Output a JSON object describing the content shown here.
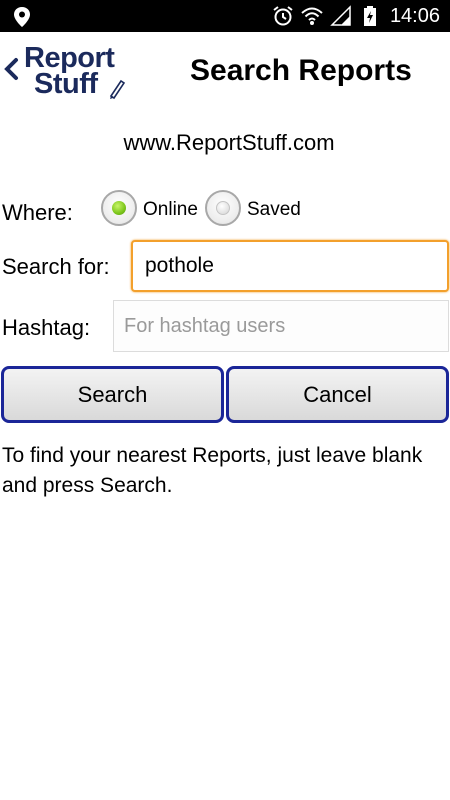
{
  "status_bar": {
    "time": "14:06",
    "icons": [
      "location-icon",
      "alarm-icon",
      "wifi-icon",
      "signal-icon",
      "battery-charging-icon"
    ]
  },
  "header": {
    "logo_line1": "Report",
    "logo_line2": "Stuff",
    "title": "Search Reports"
  },
  "site_url": "www.ReportStuff.com",
  "where": {
    "label": "Where:",
    "options": [
      {
        "label": "Online",
        "checked": true
      },
      {
        "label": "Saved",
        "checked": false
      }
    ]
  },
  "search_for": {
    "label": "Search for:",
    "value": "pothole"
  },
  "hashtag": {
    "label": "Hashtag:",
    "placeholder": "For hashtag users"
  },
  "buttons": {
    "search": "Search",
    "cancel": "Cancel"
  },
  "help_text": "To find your nearest Reports, just leave blank and press Search.",
  "colors": {
    "button_border": "#1b2698",
    "focus_border": "#f3a02c",
    "logo": "#1b2a5c",
    "radio_checked": "#7cc51a"
  }
}
